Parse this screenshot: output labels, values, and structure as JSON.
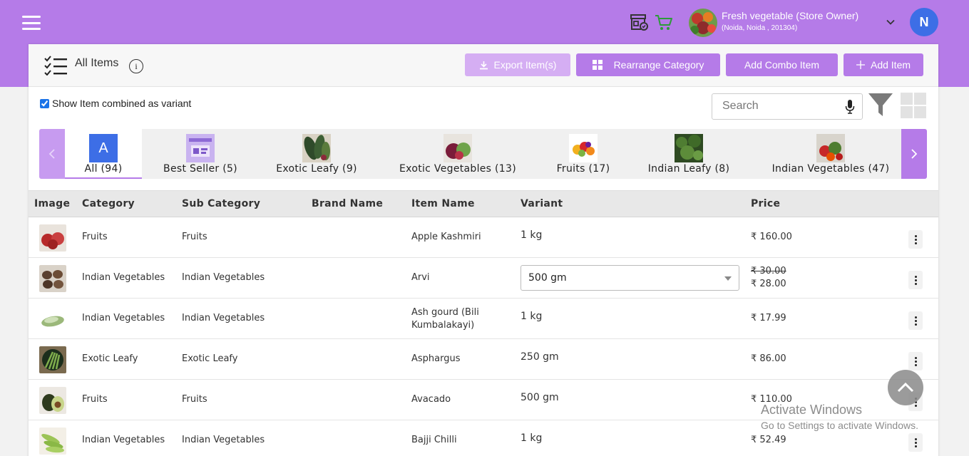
{
  "header": {
    "store_name": "Fresh vegetable (Store Owner)",
    "store_address": "(Noida, Noida , 201304)",
    "user_initial": "N"
  },
  "toolbar": {
    "title": "All Items",
    "info": "i",
    "export_label": "Export Item(s)",
    "rearrange_label": "Rearrange Category",
    "combo_label": "Add Combo Item",
    "add_label": "Add Item"
  },
  "filters": {
    "variant_toggle_label": "Show Item combined as variant",
    "variant_toggle_checked": true,
    "search_placeholder": "Search"
  },
  "categories": [
    {
      "label": "All (94)",
      "icon": "letter-a-tile",
      "badge": "A",
      "active": true
    },
    {
      "label": "Best Seller (5)",
      "icon": "best-seller-banner"
    },
    {
      "label": "Exotic Leafy (9)",
      "icon": "exotic-leafy-photo"
    },
    {
      "label": "Exotic Vegetables (13)",
      "icon": "exotic-vegetables-photo"
    },
    {
      "label": "Fruits (17)",
      "icon": "fruits-photo"
    },
    {
      "label": "Indian Leafy (8)",
      "icon": "indian-leafy-photo"
    },
    {
      "label": "Indian Vegetables (47)",
      "icon": "indian-vegetables-photo"
    }
  ],
  "table": {
    "columns": [
      "Image",
      "Category",
      "Sub Category",
      "Brand Name",
      "Item Name",
      "Variant",
      "Price"
    ],
    "rows": [
      {
        "category": "Fruits",
        "sub_category": "Fruits",
        "brand": "",
        "item_name": "Apple Kashmiri",
        "variant": "1 kg",
        "variant_type": "text",
        "price": "₹ 160.00",
        "thumb": "apple-photo"
      },
      {
        "category": "Indian Vegetables",
        "sub_category": "Indian Vegetables",
        "brand": "",
        "item_name": "Arvi",
        "variant": "500 gm",
        "variant_type": "select",
        "price_old": "₹ 30.00",
        "price": "₹ 28.00",
        "thumb": "arvi-photo"
      },
      {
        "category": "Indian Vegetables",
        "sub_category": "Indian Vegetables",
        "brand": "",
        "item_name": "Ash gourd (Bili Kumbalakayi)",
        "variant": "1 kg",
        "variant_type": "text",
        "price": "₹ 17.99",
        "thumb": "ash-gourd-photo"
      },
      {
        "category": "Exotic Leafy",
        "sub_category": "Exotic Leafy",
        "brand": "",
        "item_name": "Asphargus",
        "variant": "250 gm",
        "variant_type": "text",
        "price": "₹ 86.00",
        "thumb": "asparagus-photo"
      },
      {
        "category": "Fruits",
        "sub_category": "Fruits",
        "brand": "",
        "item_name": "Avacado",
        "variant": "500 gm",
        "variant_type": "text",
        "price": "₹ 110.00",
        "thumb": "avocado-photo"
      },
      {
        "category": "Indian Vegetables",
        "sub_category": "Indian Vegetables",
        "brand": "",
        "item_name": "Bajji Chilli",
        "variant": "1 kg",
        "variant_type": "text",
        "price": "₹ 52.49",
        "thumb": "chilli-photo"
      }
    ]
  },
  "watermark": {
    "line1": "Activate Windows",
    "line2": "Go to Settings to activate Windows."
  },
  "colors": {
    "accent": "#b57be8",
    "accent_light": "#d5aef3",
    "avatar": "#3d6ee6"
  }
}
